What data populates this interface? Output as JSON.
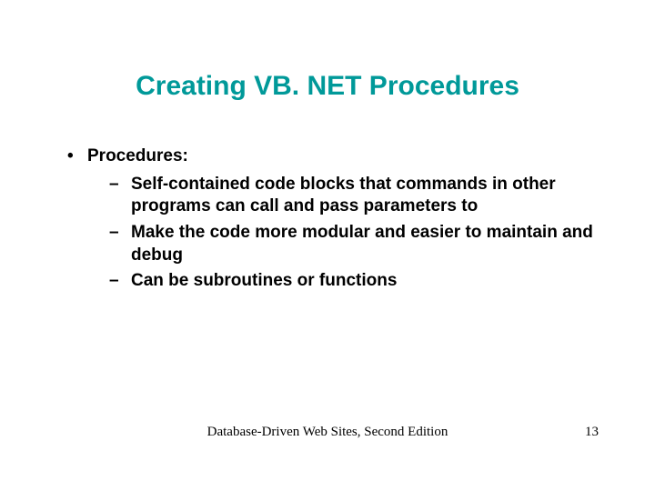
{
  "title": "Creating VB. NET Procedures",
  "bullets": {
    "main": "Procedures:",
    "subs": [
      "Self-contained code blocks that commands in other programs can call and pass parameters to",
      "Make the code more modular and easier to maintain and debug",
      "Can be subroutines or functions"
    ]
  },
  "footer": {
    "center": "Database-Driven Web Sites, Second Edition",
    "page": "13"
  }
}
